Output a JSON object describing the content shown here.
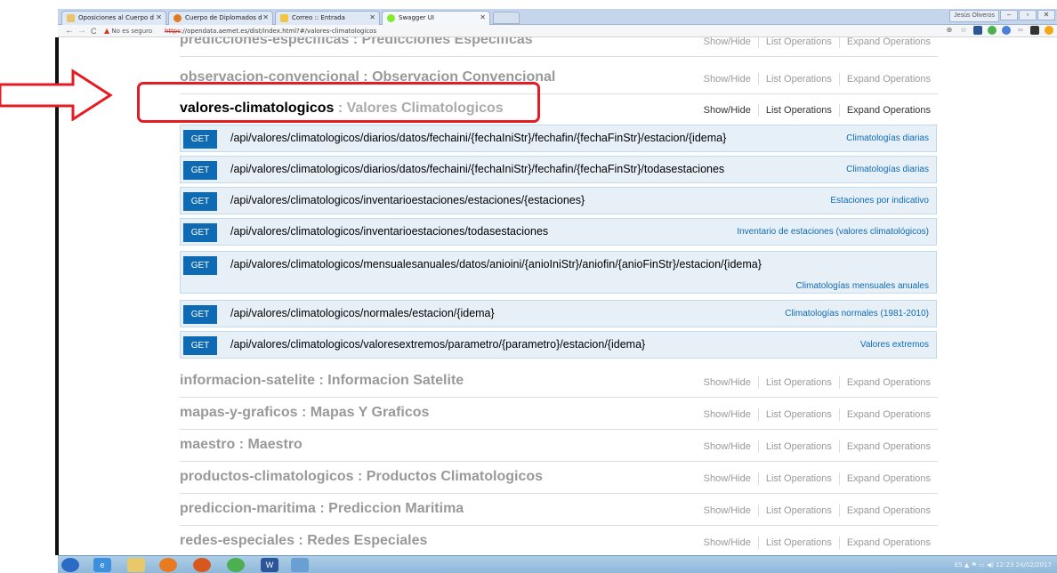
{
  "browser": {
    "tabs": [
      {
        "label": "Oposiciones al Cuerpo d",
        "favicon_color": "#e9c46a"
      },
      {
        "label": "Cuerpo de Diplomados d",
        "favicon_color": "#e07b24"
      },
      {
        "label": "Correo :: Entrada",
        "favicon_color": "#f4c542"
      },
      {
        "label": "Swagger UI",
        "favicon_color": "#85ea2d"
      }
    ],
    "user_label": "Jesús Oliveros",
    "security_warning": "No es seguro",
    "url_scheme": "https",
    "url_rest": "://opendata.aemet.es/dist/index.html?#/valores-climatologicos"
  },
  "swagger": {
    "show_hide": "Show/Hide",
    "list_operations": "List Operations",
    "expand_operations": "Expand Operations",
    "resources_top": [
      {
        "name": "predicciones-especificas",
        "desc": "Predicciones Especificas"
      },
      {
        "name": "observacion-convencional",
        "desc": "Observacion Convencional"
      }
    ],
    "active_resource": {
      "name": "valores-climatologicos",
      "desc": "Valores Climatologicos"
    },
    "operations": [
      {
        "method": "GET",
        "path": "/api/valores/climatologicos/diarios/datos/fechaini/{fechaIniStr}/fechafin/{fechaFinStr}/estacion/{idema}",
        "summary": "Climatologías diarias"
      },
      {
        "method": "GET",
        "path": "/api/valores/climatologicos/diarios/datos/fechaini/{fechaIniStr}/fechafin/{fechaFinStr}/todasestaciones",
        "summary": "Climatologías diarias"
      },
      {
        "method": "GET",
        "path": "/api/valores/climatologicos/inventarioestaciones/estaciones/{estaciones}",
        "summary": "Estaciones por indicativo"
      },
      {
        "method": "GET",
        "path": "/api/valores/climatologicos/inventarioestaciones/todasestaciones",
        "summary": "Inventario de estaciones (valores climatológicos)"
      },
      {
        "method": "GET",
        "path": "/api/valores/climatologicos/mensualesanuales/datos/anioini/{anioIniStr}/aniofin/{anioFinStr}/estacion/{idema}",
        "summary": "Climatologías mensuales anuales"
      },
      {
        "method": "GET",
        "path": "/api/valores/climatologicos/normales/estacion/{idema}",
        "summary": "Climatologías normales (1981-2010)"
      },
      {
        "method": "GET",
        "path": "/api/valores/climatologicos/valoresextremos/parametro/{parametro}/estacion/{idema}",
        "summary": "Valores extremos"
      }
    ],
    "resources_bottom": [
      {
        "name": "informacion-satelite",
        "desc": "Informacion Satelite"
      },
      {
        "name": "mapas-y-graficos",
        "desc": "Mapas Y Graficos"
      },
      {
        "name": "maestro",
        "desc": "Maestro"
      },
      {
        "name": "productos-climatologicos",
        "desc": "Productos Climatologicos"
      },
      {
        "name": "prediccion-maritima",
        "desc": "Prediccion Maritima"
      },
      {
        "name": "redes-especiales",
        "desc": "Redes Especiales"
      }
    ]
  },
  "taskbar": {
    "tray_lang": "ES",
    "time": "12:23",
    "date": "24/02/2017"
  },
  "colors": {
    "get_blue": "#0f6ab4",
    "annotation_red": "#e51c24",
    "op_bg": "#e7f0f7"
  }
}
